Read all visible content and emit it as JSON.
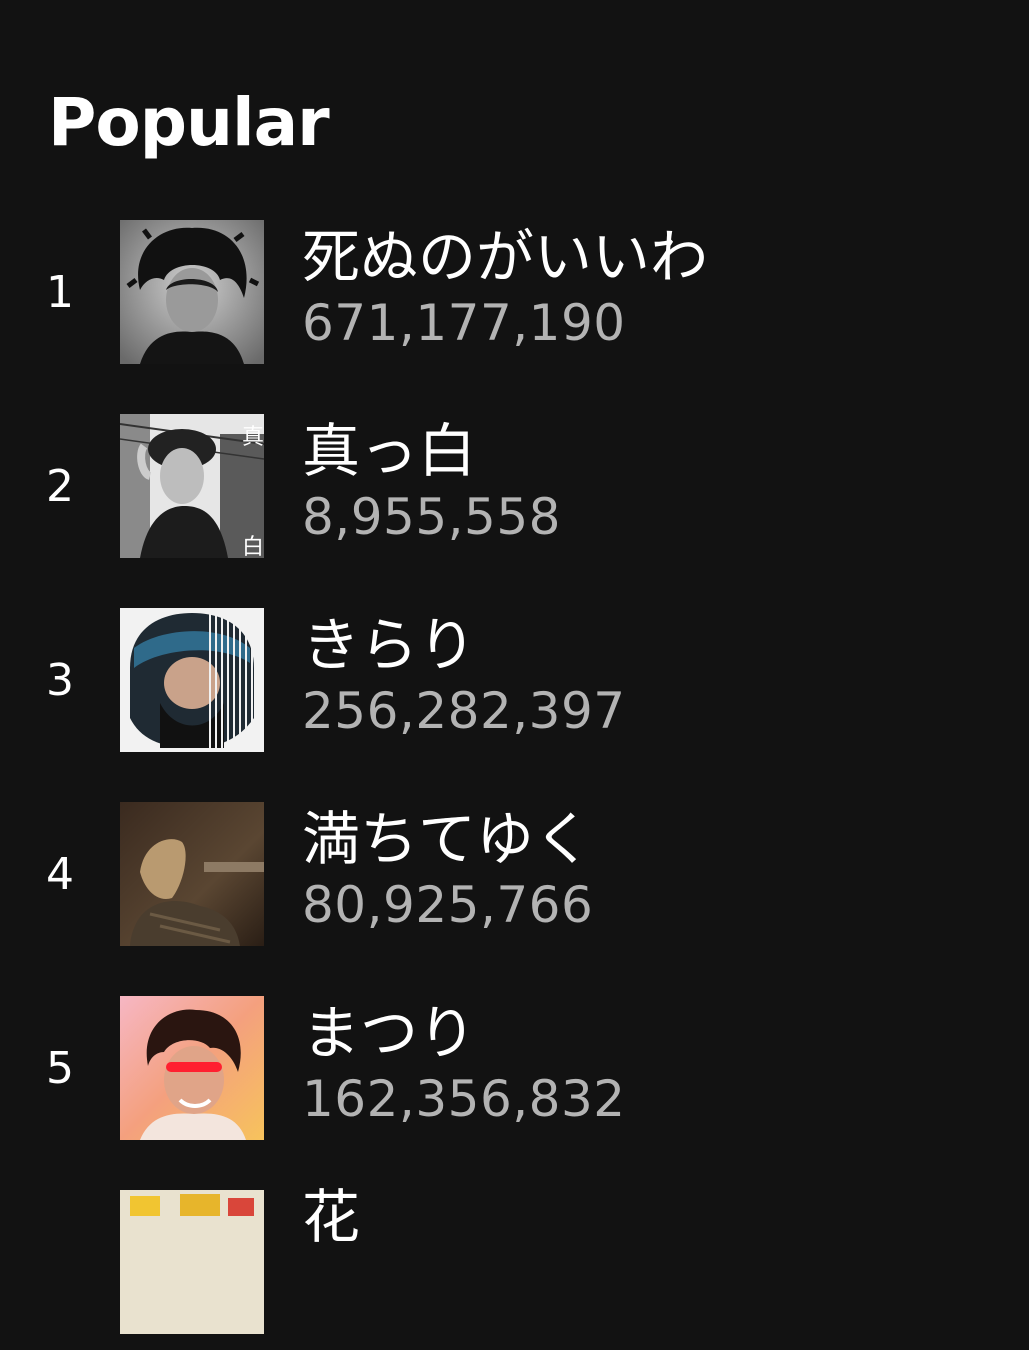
{
  "section": {
    "title": "Popular"
  },
  "tracks": [
    {
      "rank": "1",
      "title": "死ぬのがいいわ",
      "plays": "671,177,190",
      "cover_icon": "album-cover-bw-portrait-icon"
    },
    {
      "rank": "2",
      "title": "真っ白",
      "plays": "8,955,558",
      "cover_icon": "album-cover-street-portrait-icon"
    },
    {
      "rank": "3",
      "title": "きらり",
      "plays": "256,282,397",
      "cover_icon": "album-cover-striped-helmet-icon"
    },
    {
      "rank": "4",
      "title": "満ちてゆく",
      "plays": "80,925,766",
      "cover_icon": "album-cover-dark-portrait-icon"
    },
    {
      "rank": "5",
      "title": "まつり",
      "plays": "162,356,832",
      "cover_icon": "album-cover-pink-portrait-icon"
    },
    {
      "rank": "",
      "title": "花",
      "plays": "",
      "cover_icon": "album-cover-yellow-icon"
    }
  ],
  "colors": {
    "background": "#121212",
    "title_text": "#ffffff",
    "plays_text": "#b3b3b3"
  }
}
